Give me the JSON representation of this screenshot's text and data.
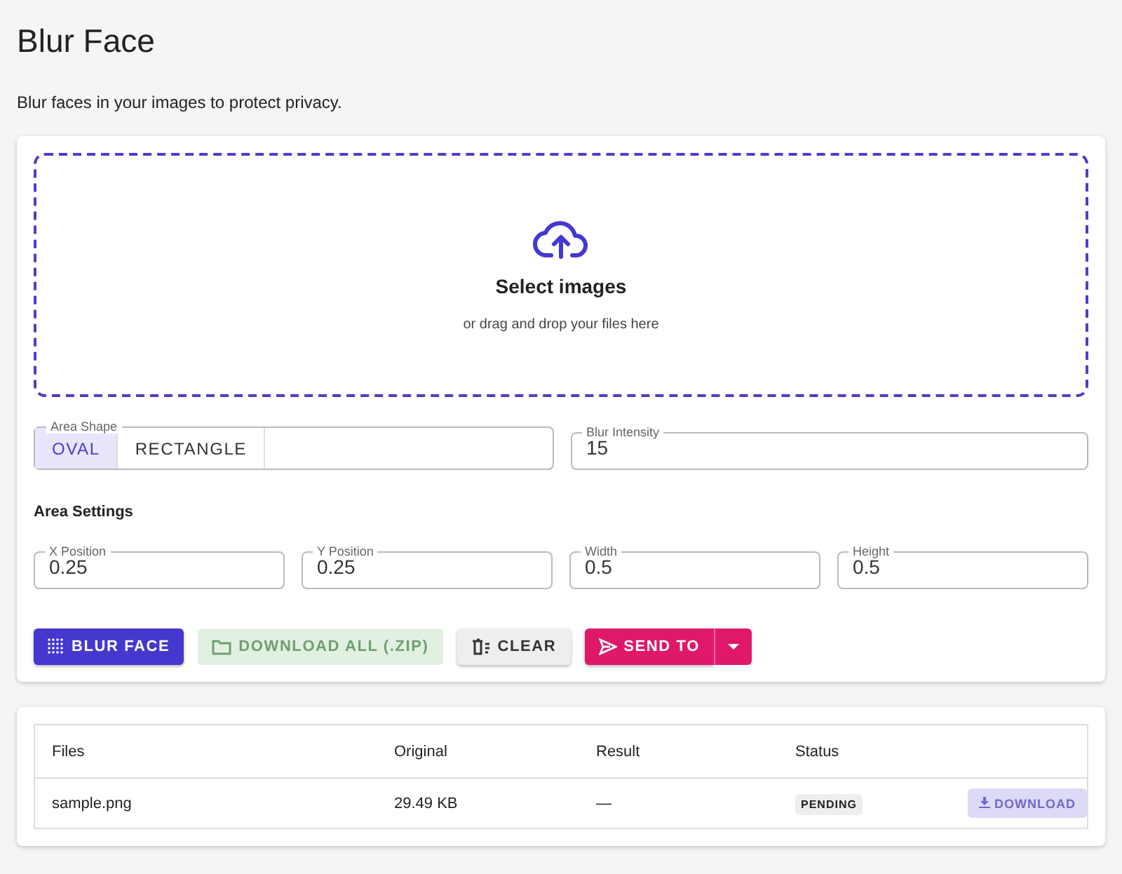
{
  "page": {
    "title": "Blur Face",
    "subtitle": "Blur faces in your images to protect privacy."
  },
  "dropzone": {
    "title": "Select images",
    "hint": "or drag and drop your files here"
  },
  "area_shape": {
    "label": "Area Shape",
    "options": [
      {
        "label": "OVAL",
        "selected": true
      },
      {
        "label": "RECTANGLE",
        "selected": false
      }
    ]
  },
  "blur_intensity": {
    "label": "Blur Intensity",
    "value": "15"
  },
  "area_settings": {
    "heading": "Area Settings",
    "fields": [
      {
        "label": "X Position",
        "value": "0.25"
      },
      {
        "label": "Y Position",
        "value": "0.25"
      },
      {
        "label": "Width",
        "value": "0.5"
      },
      {
        "label": "Height",
        "value": "0.5"
      }
    ]
  },
  "actions": [
    {
      "kind": "blur",
      "label": "BLUR FACE",
      "disabled": false
    },
    {
      "kind": "zip",
      "label": "DOWNLOAD ALL (.ZIP)",
      "disabled": true
    },
    {
      "kind": "clear",
      "label": "CLEAR",
      "disabled": false
    },
    {
      "kind": "send",
      "label": "SEND TO",
      "disabled": false
    }
  ],
  "table": {
    "columns": [
      "Files",
      "Original",
      "Result",
      "Status"
    ],
    "rows": [
      {
        "file": "sample.png",
        "original": "29.49 KB",
        "result": "—",
        "status": "PENDING",
        "download": {
          "label": "DOWNLOAD",
          "disabled": true
        }
      }
    ]
  }
}
